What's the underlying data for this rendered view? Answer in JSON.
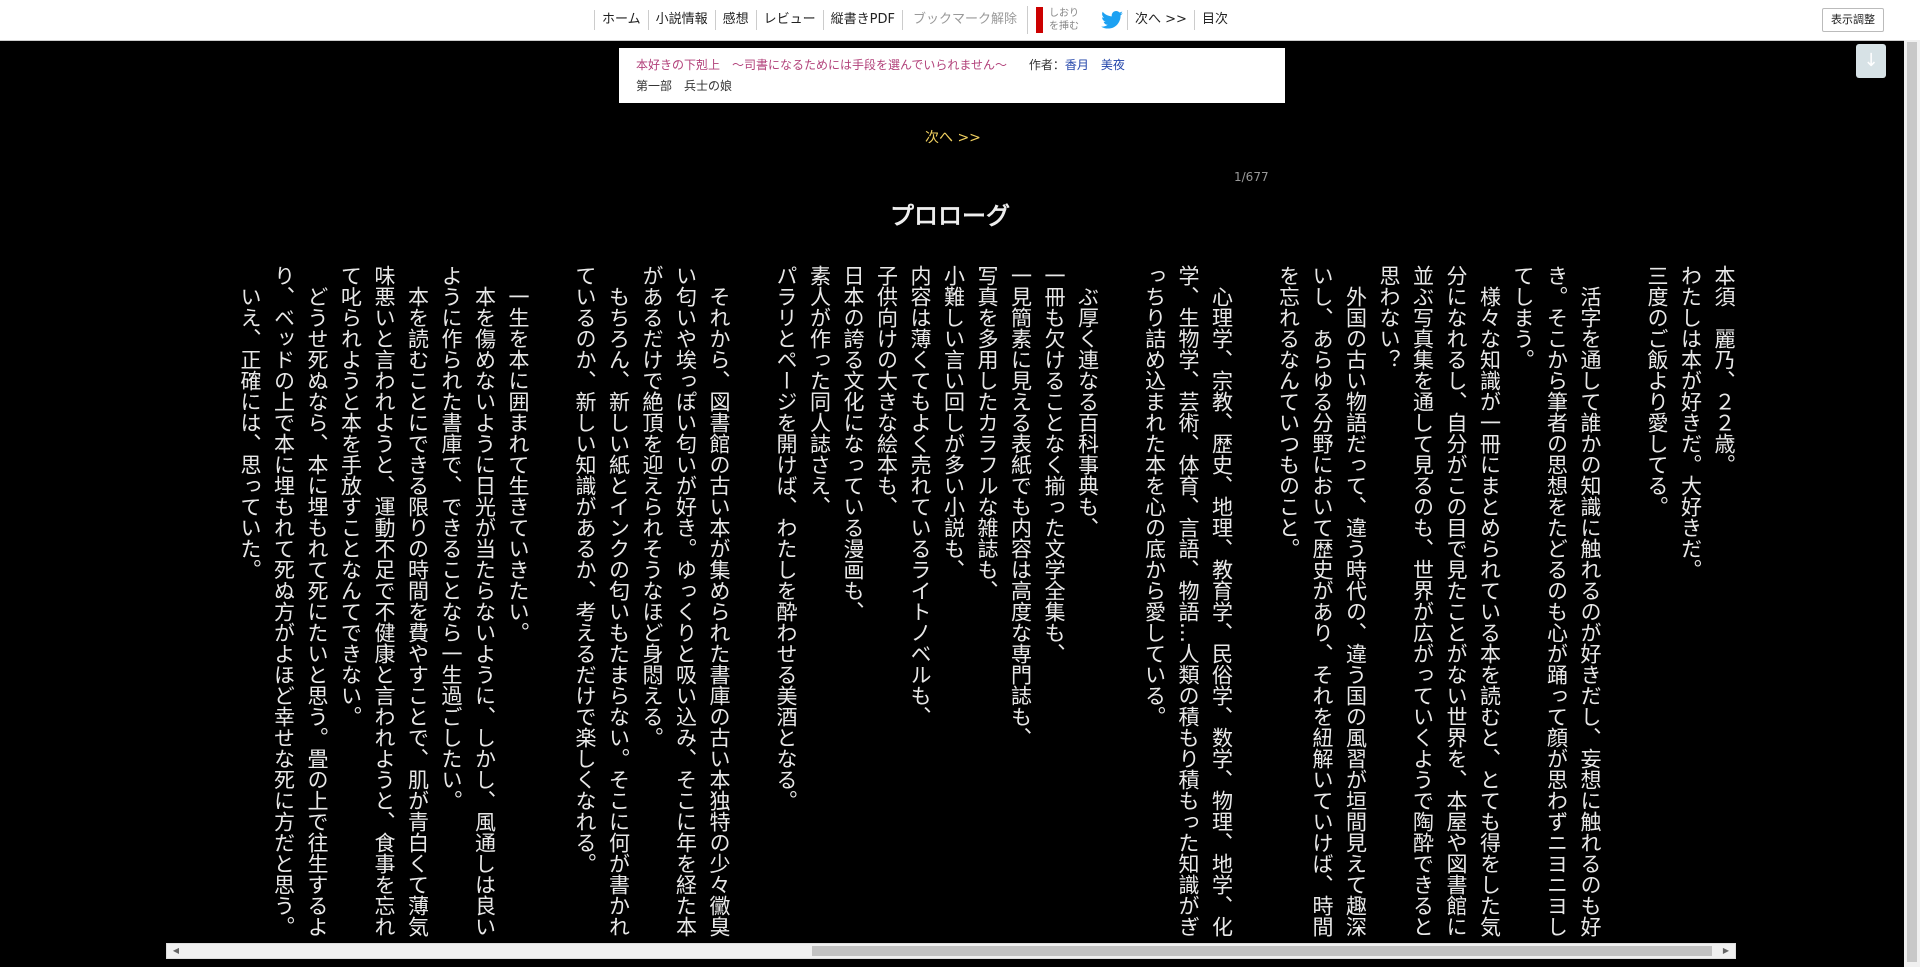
{
  "nav": {
    "items": [
      "ホーム",
      "小説情報",
      "感想",
      "レビュー",
      "縦書きPDF"
    ],
    "bookmark_remove": "ブックマーク解除",
    "shiori_label": "しおり\nを挿む",
    "next": "次へ >>",
    "toc": "目次",
    "display_adjust": "表示調整"
  },
  "info": {
    "series_title": "本好きの下剋上　～司書になるためには手段を選んでいられません～",
    "author_label": "作者：",
    "author": "香月　美夜",
    "chapter": "第一部　兵士の娘"
  },
  "down_button": "↓",
  "next_link": "次へ >>",
  "page_count": "1/677",
  "chapter_title": "プロローグ",
  "body": {
    "paragraphs": [
      "本須　麗乃、２２歳。",
      "わたしは本が好きだ。大好きだ。",
      "三度のご飯より愛してる。",
      "",
      "　活字を通して誰かの知識に触れるのが好きだし、妄想に触れるのも好き。そこから筆者の思想をたどるのも心が踊って顔が思わずニヨニヨしてしまう。",
      "　様々な知識が一冊にまとめられている本を読むと、とても得をした気分になれるし、自分がこの目で見たことがない世界を、本屋や図書館に並ぶ写真集を通して見るのも、世界が広がっていくようで陶酔できると思わない？",
      "　外国の古い物語だって、違う時代の、違う国の風習が垣間見えて趣深いし、あらゆる分野において歴史があり、それを紐解いていけば、時間を忘れるなんていつものこと。",
      "",
      "　心理学、宗教、歴史、地理、教育学、民俗学、数学、物理、地学、化学、生物学、芸術、体育、言語、物語…人類の積もり積もった知識がぎっちり詰め込まれた本を心の底から愛している。",
      "",
      "　ぶ厚く連なる百科事典も、",
      "一冊も欠けることなく揃った文学全集も、",
      "一見簡素に見える表紙でも内容は高度な専門誌も、",
      "写真を多用したカラフルな雑誌も、",
      "小難しい言い回しが多い小説も、",
      "内容は薄くてもよく売れているライトノベルも、",
      "子供向けの大きな絵本も、",
      "日本の誇る文化になっている漫画も、",
      "素人が作った同人誌さえ、",
      "パラリとページを開けば、わたしを酔わせる美酒となる。",
      "",
      "　それから、図書館の古い本が集められた書庫の古い本独特の少々黴臭い匂いや埃っぽい匂いが好き。ゆっくりと吸い込み、そこに年を経た本があるだけで絶頂を迎えられそうなほど身悶える。",
      "　もちろん、新しい紙とインクの匂いもたまらない。そこに何が書かれているのか、新しい知識があるか、考えるだけで楽しくなれる。",
      "",
      "　一生を本に囲まれて生きていきたい。",
      "　本を傷めないように日光が当たらないように、しかし、風通しは良いように作られた書庫で、できることなら一生過ごしたい。",
      "　本を読むことにできる限りの時間を費やすことで、肌が青白くて薄気味悪いと言われようと、運動不足で不健康と言われようと、食事を忘れて叱られようと本を手放すことなんてできない。",
      "　どうせ死ぬなら、本に埋もれて死にたいと思う。畳の上で往生するより、ベッドの上で本に埋もれて死ぬ方がよほど幸せな死に方だと思う。",
      "　いえ、正確には、思っていた。"
    ]
  }
}
